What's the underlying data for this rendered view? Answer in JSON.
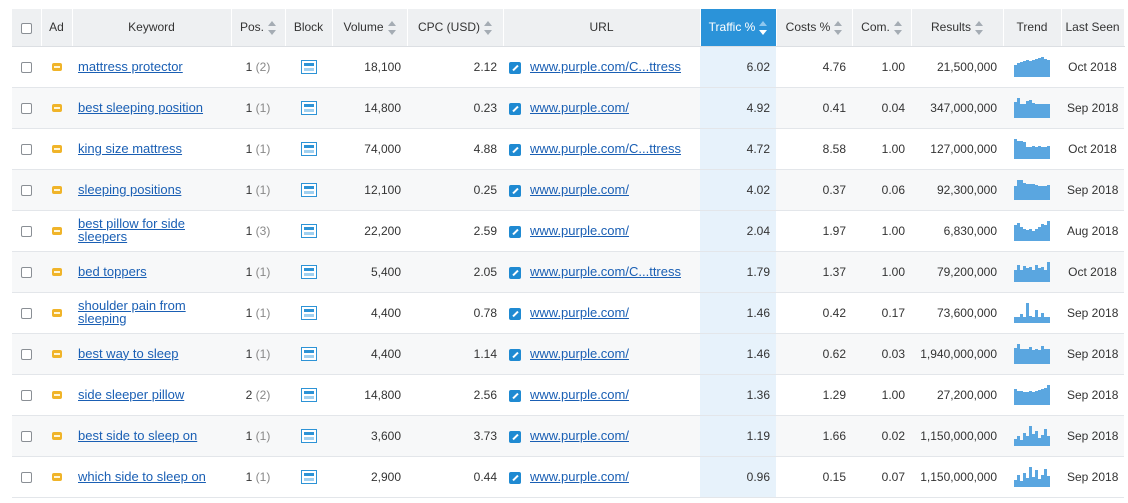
{
  "columns": {
    "ad": "Ad",
    "keyword": "Keyword",
    "pos": "Pos.",
    "block": "Block",
    "volume": "Volume",
    "cpc": "CPC (USD)",
    "url": "URL",
    "traffic": "Traffic %",
    "costs": "Costs %",
    "com": "Com.",
    "results": "Results",
    "trend": "Trend",
    "last_seen": "Last Seen"
  },
  "rows": [
    {
      "keyword": "mattress protector",
      "pos": "1",
      "pos_prev": "(2)",
      "volume": "18,100",
      "cpc": "2.12",
      "url": "www.purple.com/C...ttress",
      "traffic": "6.02",
      "costs": "4.76",
      "com": "1.00",
      "results": "21,500,000",
      "last_seen": "Oct 2018",
      "trend": [
        0.6,
        0.7,
        0.75,
        0.8,
        0.85,
        0.8,
        0.85,
        0.9,
        0.95,
        1,
        0.9,
        0.85
      ]
    },
    {
      "keyword": "best sleeping position",
      "pos": "1",
      "pos_prev": "(1)",
      "volume": "14,800",
      "cpc": "0.23",
      "url": "www.purple.com/",
      "traffic": "4.92",
      "costs": "0.41",
      "com": "0.04",
      "results": "347,000,000",
      "last_seen": "Sep 2018",
      "trend": [
        0.8,
        1,
        0.7,
        0.7,
        0.85,
        0.9,
        0.75,
        0.7,
        0.7,
        0.7,
        0.7,
        0.7
      ]
    },
    {
      "keyword": "king size mattress",
      "pos": "1",
      "pos_prev": "(1)",
      "volume": "74,000",
      "cpc": "4.88",
      "url": "www.purple.com/C...ttress",
      "traffic": "4.72",
      "costs": "8.58",
      "com": "1.00",
      "results": "127,000,000",
      "last_seen": "Oct 2018",
      "trend": [
        1,
        0.9,
        0.9,
        0.85,
        0.6,
        0.6,
        0.65,
        0.6,
        0.65,
        0.6,
        0.6,
        0.65
      ]
    },
    {
      "keyword": "sleeping positions",
      "pos": "1",
      "pos_prev": "(1)",
      "volume": "12,100",
      "cpc": "0.25",
      "url": "www.purple.com/",
      "traffic": "4.02",
      "costs": "0.37",
      "com": "0.06",
      "results": "92,300,000",
      "last_seen": "Sep 2018",
      "trend": [
        0.7,
        1,
        1,
        0.85,
        0.8,
        0.8,
        0.8,
        0.75,
        0.7,
        0.7,
        0.7,
        0.75
      ]
    },
    {
      "keyword": "best pillow for side sleepers",
      "pos": "1",
      "pos_prev": "(3)",
      "volume": "22,200",
      "cpc": "2.59",
      "url": "www.purple.com/",
      "traffic": "2.04",
      "costs": "1.97",
      "com": "1.00",
      "results": "6,830,000",
      "last_seen": "Aug 2018",
      "trend": [
        0.8,
        0.9,
        0.7,
        0.6,
        0.55,
        0.6,
        0.5,
        0.6,
        0.7,
        0.85,
        0.8,
        1
      ]
    },
    {
      "keyword": "bed toppers",
      "pos": "1",
      "pos_prev": "(1)",
      "volume": "5,400",
      "cpc": "2.05",
      "url": "www.purple.com/C...ttress",
      "traffic": "1.79",
      "costs": "1.37",
      "com": "1.00",
      "results": "79,200,000",
      "last_seen": "Oct 2018",
      "trend": [
        0.6,
        0.85,
        0.6,
        0.8,
        0.7,
        0.75,
        0.6,
        0.85,
        0.7,
        0.75,
        0.6,
        1
      ]
    },
    {
      "keyword": "shoulder pain from sleeping",
      "pos": "1",
      "pos_prev": "(1)",
      "volume": "4,400",
      "cpc": "0.78",
      "url": "www.purple.com/",
      "traffic": "1.46",
      "costs": "0.42",
      "com": "0.17",
      "results": "73,600,000",
      "last_seen": "Sep 2018",
      "trend": [
        0.3,
        0.3,
        0.45,
        0.3,
        1,
        0.35,
        0.3,
        0.65,
        0.3,
        0.5,
        0.3,
        0.3
      ]
    },
    {
      "keyword": "best way to sleep",
      "pos": "1",
      "pos_prev": "(1)",
      "volume": "4,400",
      "cpc": "1.14",
      "url": "www.purple.com/",
      "traffic": "1.46",
      "costs": "0.62",
      "com": "0.03",
      "results": "1,940,000,000",
      "last_seen": "Sep 2018",
      "trend": [
        0.8,
        1,
        0.75,
        0.75,
        0.75,
        0.85,
        0.7,
        0.75,
        0.7,
        0.9,
        0.75,
        0.75
      ]
    },
    {
      "keyword": "side sleeper pillow",
      "pos": "2",
      "pos_prev": "(2)",
      "volume": "14,800",
      "cpc": "2.56",
      "url": "www.purple.com/",
      "traffic": "1.36",
      "costs": "1.29",
      "com": "1.00",
      "results": "27,200,000",
      "last_seen": "Sep 2018",
      "trend": [
        0.8,
        0.7,
        0.7,
        0.65,
        0.65,
        0.7,
        0.65,
        0.7,
        0.75,
        0.8,
        0.85,
        1
      ]
    },
    {
      "keyword": "best side to sleep on",
      "pos": "1",
      "pos_prev": "(1)",
      "volume": "3,600",
      "cpc": "3.73",
      "url": "www.purple.com/",
      "traffic": "1.19",
      "costs": "1.66",
      "com": "0.02",
      "results": "1,150,000,000",
      "last_seen": "Sep 2018",
      "trend": [
        0.35,
        0.5,
        0.3,
        0.65,
        0.5,
        1,
        0.6,
        0.75,
        0.4,
        0.55,
        0.85,
        0.5
      ]
    },
    {
      "keyword": "which side to sleep on",
      "pos": "1",
      "pos_prev": "(1)",
      "volume": "2,900",
      "cpc": "0.44",
      "url": "www.purple.com/",
      "traffic": "0.96",
      "costs": "0.15",
      "com": "0.07",
      "results": "1,150,000,000",
      "last_seen": "Sep 2018",
      "trend": [
        0.35,
        0.6,
        0.3,
        0.7,
        0.45,
        1,
        0.5,
        0.85,
        0.4,
        0.6,
        0.9,
        0.55
      ]
    }
  ],
  "colors": {
    "active_header": "#2b93d9",
    "link": "#1a5fb4",
    "traffic_highlight": "#e7f2fb",
    "trend_bar": "#5aa6e0"
  }
}
